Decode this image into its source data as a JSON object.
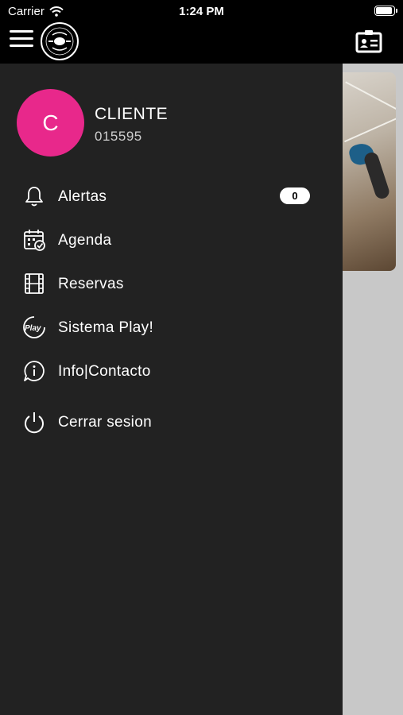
{
  "status_bar": {
    "carrier": "Carrier",
    "time": "1:24 PM",
    "battery_level": 1.0
  },
  "header": {
    "logo_text_top": "MÁS QUE",
    "logo_text_bottom": "PÁDEL",
    "icons": [
      "menu-icon",
      "contact-card-icon"
    ]
  },
  "user": {
    "initial": "C",
    "name": "CLIENTE",
    "id": "015595",
    "avatar_color": "#e8288b"
  },
  "menu": {
    "items": [
      {
        "label": "Alertas",
        "icon": "bell-icon",
        "badge": "0"
      },
      {
        "label": "Agenda",
        "icon": "calendar-check-icon"
      },
      {
        "label": "Reservas",
        "icon": "film-icon"
      },
      {
        "label": "Sistema Play!",
        "icon": "play-badge-icon"
      },
      {
        "label": "Info|Contacto",
        "icon": "info-bubble-icon"
      },
      {
        "label": "Cerrar sesion",
        "icon": "power-icon"
      }
    ]
  },
  "colors": {
    "drawer_bg": "#222222",
    "accent": "#e8288b",
    "background": "#c8c8c8"
  }
}
